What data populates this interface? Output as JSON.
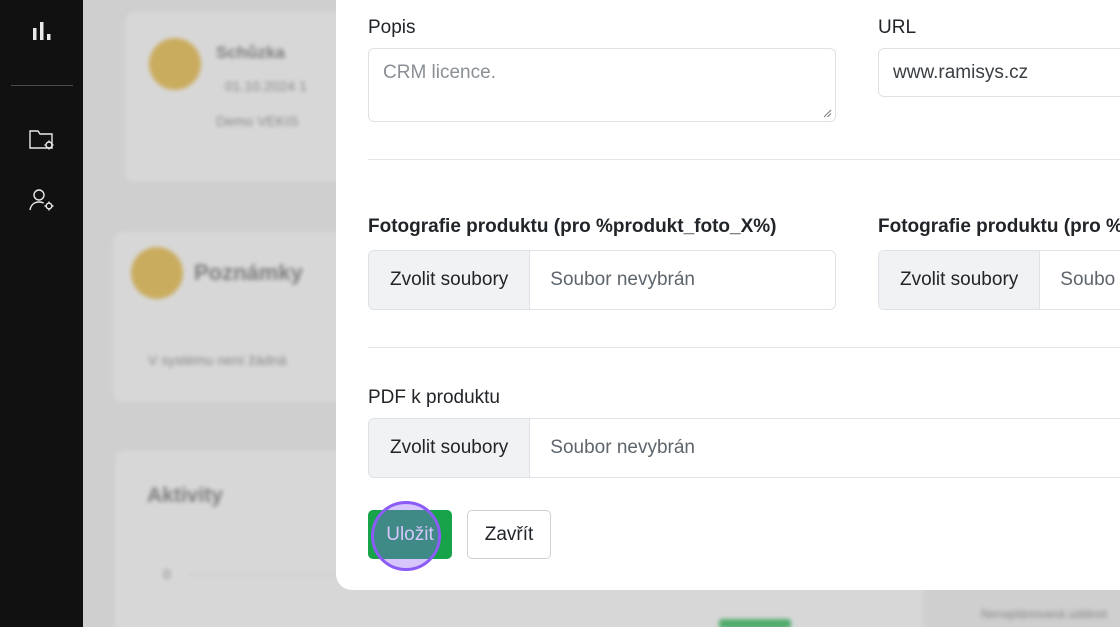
{
  "sidebar": {
    "icons": [
      "bar-chart-icon",
      "folder-settings-icon",
      "user-settings-icon"
    ]
  },
  "background": {
    "card1_title": "Schůzka",
    "card1_meta": "01.10.2024 1",
    "card1_sub": "Demo VEKIS",
    "notes_title": "Poznámky",
    "notes_empty": "V systému není žádná",
    "activity_title": "Aktivity",
    "activity_axis": "0",
    "bottom_right_text": "Nenaplánovaná událost"
  },
  "form": {
    "popis_label": "Popis",
    "popis_placeholder": "CRM licence.",
    "url_label": "URL",
    "url_value": "www.ramisys.cz",
    "photo1_label": "Fotografie produktu (pro %produkt_foto_X%)",
    "photo2_label": "Fotografie produktu (pro %",
    "file_button": "Zvolit soubory",
    "file_none": "Soubor nevybrán",
    "file_none_cut": "Soubo",
    "pdf_label": "PDF k produktu",
    "save_label": "Uložit",
    "close_label": "Zavřít"
  },
  "colors": {
    "sidebar_bg": "#111111",
    "save_button": "#16a34a",
    "click_ring": "#8b5cf6"
  }
}
